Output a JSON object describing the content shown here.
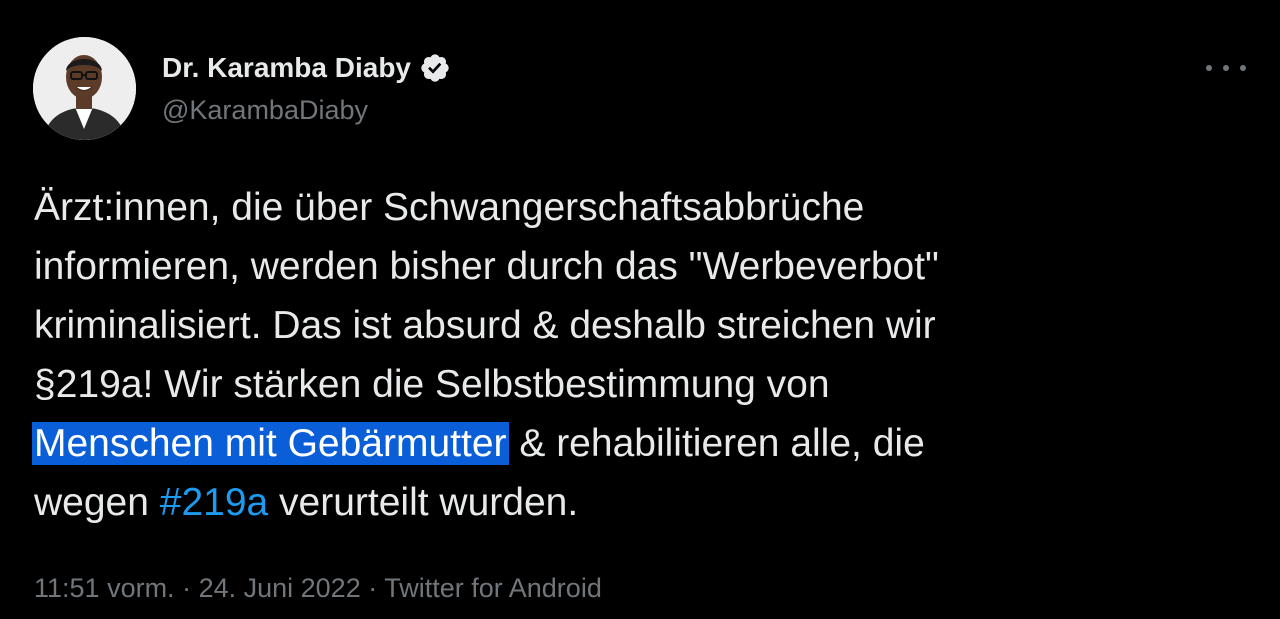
{
  "author": {
    "display_name": "Dr. Karamba Diaby",
    "handle": "@KarambaDiaby",
    "verified": true
  },
  "tweet": {
    "line1": "Ärzt:innen, die über Schwangerschaftsabbrüche",
    "line2": "informieren, werden bisher durch das \"Werbeverbot\"",
    "line3": "kriminalisiert. Das ist absurd & deshalb streichen wir",
    "line4": "§219a! Wir stärken die Selbstbestimmung von",
    "line5_highlight": "Menschen mit Gebärmutter",
    "line5_rest": " & rehabilitieren alle, die",
    "line6_pre": "wegen ",
    "hashtag": "#219a",
    "line6_post": " verurteilt wurden."
  },
  "meta": {
    "time": "11:51 vorm.",
    "sep1": " · ",
    "date": "24. Juni 2022",
    "sep2": " · ",
    "source": "Twitter for Android"
  },
  "colors": {
    "background": "#000000",
    "text": "#e7e9ea",
    "secondary": "#71767b",
    "link": "#1d9bf0",
    "selection": "#0a5fd8"
  },
  "icons": {
    "verified": "verified-badge-icon",
    "more": "more-options-icon"
  }
}
